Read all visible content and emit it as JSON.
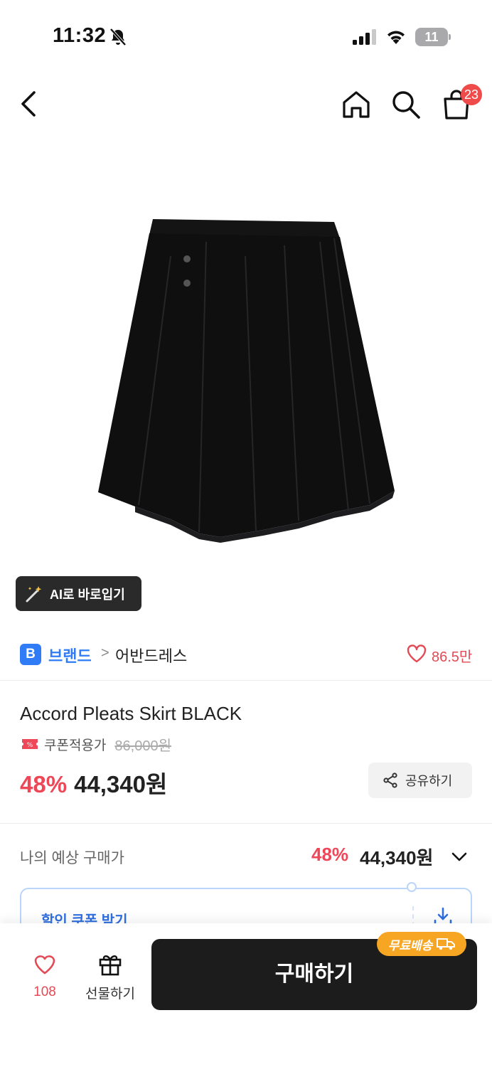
{
  "status_bar": {
    "time": "11:32",
    "battery": "11"
  },
  "nav": {
    "cart_badge": "23"
  },
  "ai_chip": {
    "label": "AI로 바로입기"
  },
  "brand": {
    "badge": "B",
    "name": "브랜드",
    "separator": ">",
    "category": "어반드레스",
    "like_count": "86.5만"
  },
  "product": {
    "title": "Accord Pleats Skirt BLACK",
    "coupon_label": "쿠폰적용가",
    "original_price": "86,000원",
    "discount": "48%",
    "sale_price": "44,340원",
    "share_label": "공유하기"
  },
  "expected": {
    "label": "나의 예상 구매가",
    "discount": "48%",
    "price": "44,340원"
  },
  "coupon_box": {
    "label": "할인 쿠폰 받기"
  },
  "bottom_bar": {
    "like_count": "108",
    "gift_label": "선물하기",
    "buy_label": "구매하기",
    "free_shipping": "무료배송"
  },
  "colors": {
    "accent_red": "#ee4758",
    "brand_blue": "#2f7cf6",
    "buy_button": "#1c1c1c",
    "shipping_badge": "#f6a623"
  }
}
